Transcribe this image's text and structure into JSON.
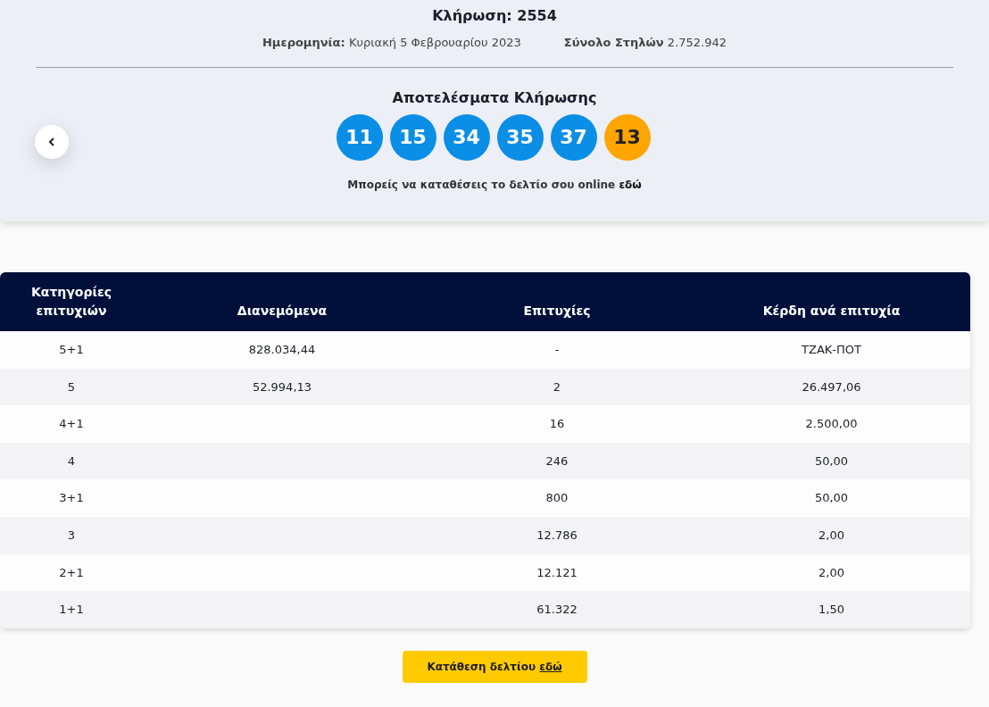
{
  "draw": {
    "title": "Κλήρωση: 2554",
    "date_label": "Ημερομηνία:",
    "date_value": "Κυριακή 5 Φεβρουαρίου 2023",
    "columns_label": "Σύνολο Στηλών",
    "columns_value": "2.752.942"
  },
  "results": {
    "title": "Αποτελέσματα Κλήρωσης",
    "balls": [
      {
        "number": "11",
        "kind": "main"
      },
      {
        "number": "15",
        "kind": "main"
      },
      {
        "number": "34",
        "kind": "main"
      },
      {
        "number": "35",
        "kind": "main"
      },
      {
        "number": "37",
        "kind": "main"
      },
      {
        "number": "13",
        "kind": "bonus"
      }
    ],
    "note": "Μπορείς να καταθέσεις το δελτίο σου online",
    "note_link": "εδώ"
  },
  "table": {
    "columns": [
      "Κατηγορίες επιτυχιών",
      "Διανεμόμενα",
      "Επιτυχίες",
      "Κέρδη ανά επιτυχία"
    ],
    "rows": [
      [
        "5+1",
        "828.034,44",
        "-",
        "ΤΖΑΚ-ΠΟΤ"
      ],
      [
        "5",
        "52.994,13",
        "2",
        "26.497,06"
      ],
      [
        "4+1",
        "",
        "16",
        "2.500,00"
      ],
      [
        "4",
        "",
        "246",
        "50,00"
      ],
      [
        "3+1",
        "",
        "800",
        "50,00"
      ],
      [
        "3",
        "",
        "12.786",
        "2,00"
      ],
      [
        "2+1",
        "",
        "12.121",
        "2,00"
      ],
      [
        "1+1",
        "",
        "61.322",
        "1,50"
      ]
    ]
  },
  "submit_button": {
    "text": "Κατάθεση δελτίου",
    "link": "εδώ"
  }
}
